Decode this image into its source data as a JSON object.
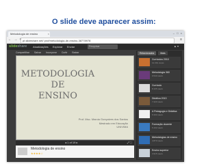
{
  "caption": "O slide deve aparecer assim:",
  "browser": {
    "tab_title": "Metodologia de ensino",
    "tab_close": "×",
    "window_controls": "– □ ×",
    "nav_glyphs": "← → ⟳",
    "url": "pt.slideshare.net/ prof/metodologia-de-ensino-38778978",
    "menu_glyph": "≡"
  },
  "site": {
    "logo_main": "slide",
    "logo_accent": "share",
    "nav": [
      "Atualizações",
      "Explorar",
      "Enviar"
    ],
    "search_placeholder": "Pesquisar",
    "user_glyph": "▲ ▾"
  },
  "toolbar": [
    "Compartilhar",
    "Salvar",
    "Incorporar",
    "Curtir",
    "Baixar"
  ],
  "slide": {
    "title_line1": "METODOLOGIA DE",
    "title_line2": "ENSINO",
    "author_line1": "Prof. Msc. Marcia Gonçalves dos Santos",
    "author_line2": "Mestrado em Educação",
    "author_line3": "UNIVIMA"
  },
  "controls": {
    "pager": "◂  1 of 19  ▸",
    "fullscreen": "⤢ ⛶"
  },
  "below": {
    "doc_title": "Metodologia de ensino",
    "stars": "★★★★☆"
  },
  "sidebar": {
    "tabs": [
      "Relacionados",
      "Mais"
    ],
    "items": [
      {
        "title": "Currículos 2010",
        "sub": "12.391 views",
        "color": "#c87030"
      },
      {
        "title": "Metodologia 360",
        "sub": "9.540 views",
        "color": "#6a3b7a"
      },
      {
        "title": "Currículo",
        "sub": "8.105 views",
        "color": "#dcdcdc"
      },
      {
        "title": "Didática 2013",
        "sub": "7.220 views",
        "color": "#7a5a3a"
      },
      {
        "title": "A Pedagogia e Didática",
        "sub": "6.334 views",
        "color": "#f0f0f0"
      },
      {
        "title": "Formação docente",
        "sub": "5.102 views",
        "color": "#3a7ac0"
      },
      {
        "title": "Metodologias de ensino",
        "sub": "4.870 views",
        "color": "#2f6db5"
      },
      {
        "title": "Ensino superior",
        "sub": "3.915 views",
        "color": "#c8d0d8"
      }
    ]
  }
}
